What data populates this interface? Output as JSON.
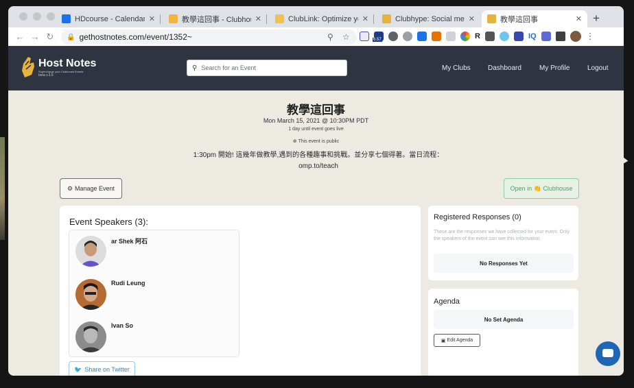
{
  "browser": {
    "tabs": [
      {
        "title": "HDcourse - Calendar - We",
        "icon": "calendar-icon",
        "color": "#1a73e8"
      },
      {
        "title": "教學這回事 - Clubhouse",
        "icon": "clubhouse-wave-icon",
        "color": "#f2b544"
      },
      {
        "title": "ClubLink: Optimize your C",
        "icon": "clublink-icon",
        "color": "#f2c14e"
      },
      {
        "title": "Clubhype: Social media p",
        "icon": "clubhype-icon",
        "color": "#e8b33c"
      },
      {
        "title": "教學這回事",
        "icon": "hostnotes-icon",
        "color": "#e7b43b",
        "active": true
      }
    ],
    "new_tab": "+",
    "url": "gethostnotes.com/event/1352~",
    "ext_badge": "6.57",
    "ext_letters": [
      "R",
      "IQ"
    ]
  },
  "site": {
    "brand": "Host Notes",
    "tagline": "Supercharge your Clubhouse Events",
    "version": "beta v.3.0",
    "search_placeholder": "Search for an Event",
    "nav": [
      "My Clubs",
      "Dashboard",
      "My Profile",
      "Logout"
    ]
  },
  "event": {
    "title": "教學這回事",
    "date": "Mon March 15, 2021 @ 10:30PM PDT",
    "countdown": "1 day until event goes live",
    "visibility": "This event is public",
    "description": "1:30pm 開始! 這幾年做教學,遇到的各種趣事和挑戰。並分享七個得著。當日流程：omp.to/teach",
    "manage_button": "Manage Event",
    "open_button": "Open in 👏 Clubhouse"
  },
  "speakers": {
    "heading": "Event Speakers (3):",
    "list": [
      {
        "name": "ar Shek 阿石"
      },
      {
        "name": "Rudi Leung"
      },
      {
        "name": "Ivan So"
      }
    ],
    "share_button": "Share on Twitter"
  },
  "responses": {
    "heading": "Registered Responses (0)",
    "description": "These are the responses we have collected for your event. Only the speakers of the event can see this information.",
    "empty": "No Responses Yet"
  },
  "agenda": {
    "heading": "Agenda",
    "empty": "No Set Agenda",
    "edit_button": "Edit Agenda"
  },
  "colors": {
    "header_bg": "#2f3441",
    "page_bg": "#edeae2",
    "accent_green": "#4aa35c",
    "twitter_blue": "#3b83c4",
    "chat_blue": "#1f67b5"
  }
}
